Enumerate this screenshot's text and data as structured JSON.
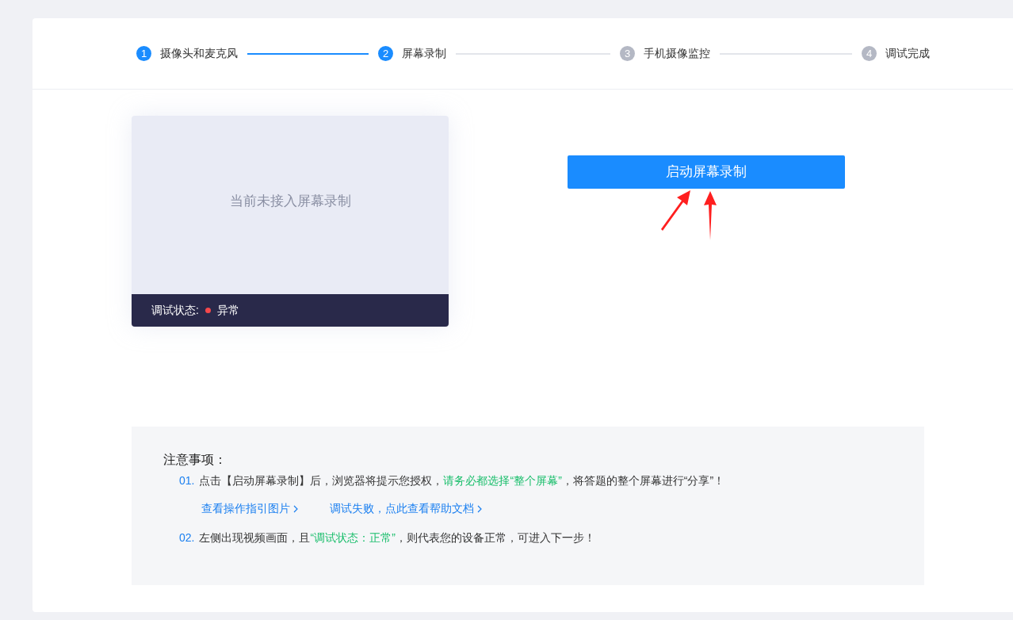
{
  "steps": [
    {
      "number": "1",
      "label": "摄像头和麦克风",
      "reached": true
    },
    {
      "number": "2",
      "label": "屏幕录制",
      "reached": true
    },
    {
      "number": "3",
      "label": "手机摄像监控",
      "reached": false
    },
    {
      "number": "4",
      "label": "调试完成",
      "reached": false
    }
  ],
  "preview": {
    "message": "当前未接入屏幕录制",
    "status_label": "调试状态:",
    "status_value": "异常",
    "status_error": true
  },
  "start_button": "启动屏幕录制",
  "notes": {
    "title": "注意事项：",
    "items": [
      {
        "number": "01.",
        "segments": [
          {
            "kind": "plain",
            "text": "点击【启动屏幕录制】后，浏览器将提示您授权，"
          },
          {
            "kind": "highlight",
            "text": "请务必都选择“整个屏幕”"
          },
          {
            "kind": "plain",
            "text": "，将答题的整个屏幕进行“分享”！"
          }
        ],
        "links": [
          "查看操作指引图片",
          "调试失败，点此查看帮助文档"
        ]
      },
      {
        "number": "02.",
        "segments": [
          {
            "kind": "plain",
            "text": "左侧出现视频画面，且"
          },
          {
            "kind": "highlight",
            "text": "“调试状态：正常”"
          },
          {
            "kind": "plain",
            "text": "，则代表您的设备正常，可进入下一步！"
          }
        ]
      }
    ]
  }
}
